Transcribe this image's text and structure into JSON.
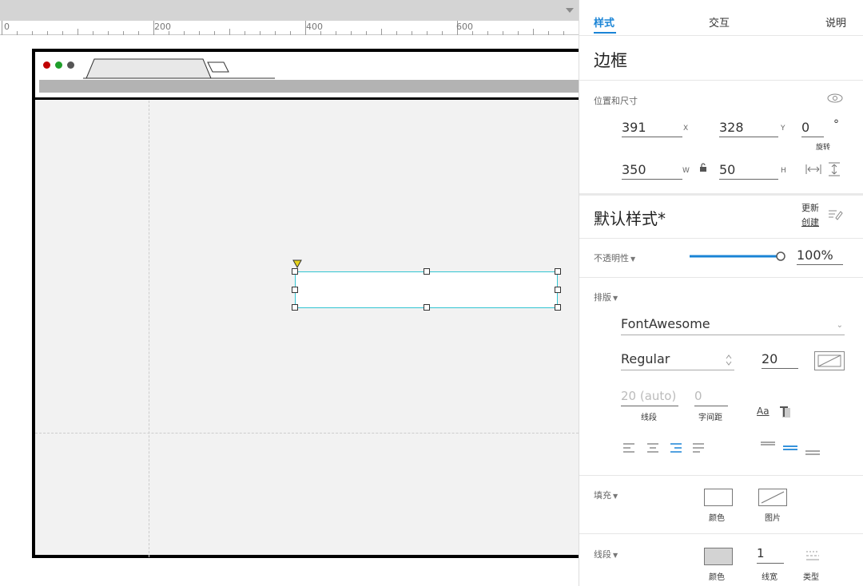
{
  "ruler": {
    "labels": [
      "0",
      "200",
      "400",
      "600"
    ]
  },
  "panel": {
    "tabs": {
      "style": "样式",
      "interact": "交互",
      "notes": "说明"
    },
    "widget_name": "边框",
    "position_size": {
      "label": "位置和尺寸",
      "x": "391",
      "x_label": "X",
      "y": "328",
      "y_label": "Y",
      "rotation": "0",
      "rotation_unit": "°",
      "rotation_label": "旋转",
      "w": "350",
      "w_label": "W",
      "h": "50",
      "h_label": "H"
    },
    "default_style": {
      "title": "默认样式*",
      "update": "更新",
      "create": "创建"
    },
    "opacity": {
      "label": "不透明性",
      "value": "100%",
      "fraction": 1.0
    },
    "typography": {
      "label": "排版",
      "font_family": "FontAwesome",
      "font_weight": "Regular",
      "font_size": "20",
      "line_height": "20 (auto)",
      "line_height_label": "线段",
      "letter_spacing": "0",
      "letter_spacing_label": "字间距",
      "text_case": "Aa"
    },
    "fill": {
      "label": "填充",
      "color_label": "颜色",
      "image_label": "图片",
      "color": "#ffffff"
    },
    "border": {
      "label": "线段",
      "color_label": "颜色",
      "width": "1",
      "width_label": "线宽",
      "type_label": "类型",
      "color": "#d3d3d3"
    }
  },
  "colors": {
    "accent": "#1a84d6",
    "selection": "#32c5d2"
  }
}
